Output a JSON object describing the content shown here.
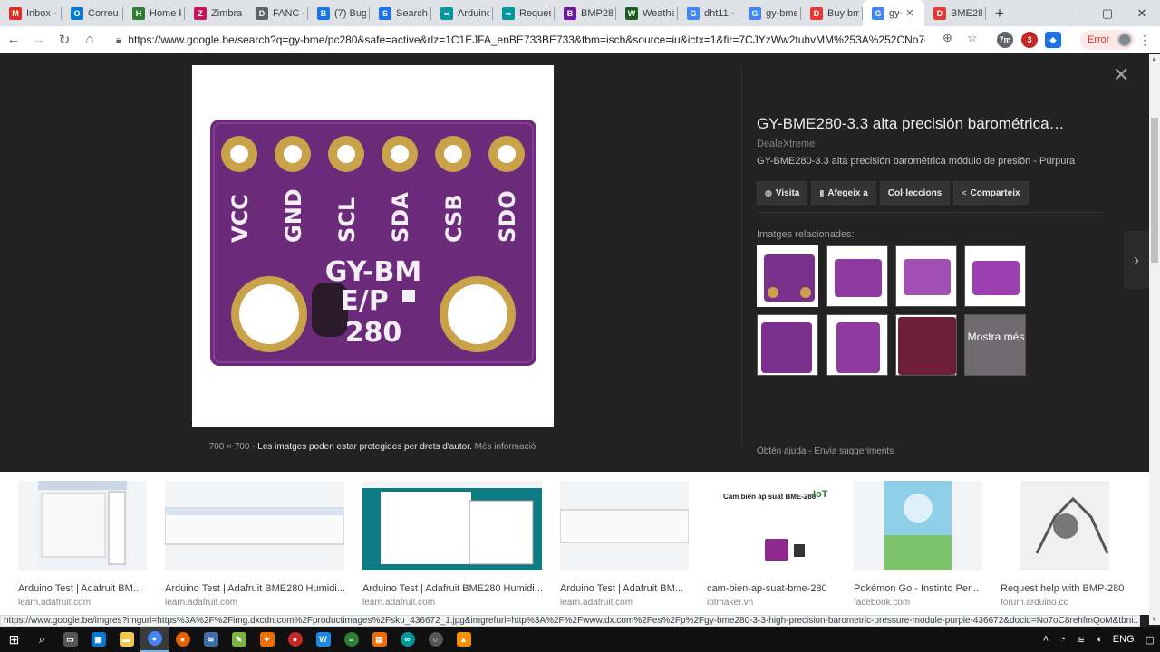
{
  "browser": {
    "tabs": [
      {
        "label": "Inbox -",
        "icon": "gmail-icon",
        "color": "#d93025",
        "glyph": "M"
      },
      {
        "label": "Correu",
        "icon": "outlook-icon",
        "color": "#0078d4",
        "glyph": "O"
      },
      {
        "label": "Home F",
        "icon": "homef-icon",
        "color": "#2e7d32",
        "glyph": "H"
      },
      {
        "label": "Zimbra",
        "icon": "zimbra-icon",
        "color": "#c2185b",
        "glyph": "Z"
      },
      {
        "label": "FANC -",
        "icon": "document-icon",
        "color": "#5f6368",
        "glyph": "D"
      },
      {
        "label": "(7) Bug",
        "icon": "bugzilla-icon",
        "color": "#1a73e8",
        "glyph": "B"
      },
      {
        "label": "Search",
        "icon": "search-tab-icon",
        "color": "#1a73e8",
        "glyph": "S"
      },
      {
        "label": "Arduino",
        "icon": "arduino-icon",
        "color": "#00979d",
        "glyph": "∞"
      },
      {
        "label": "Reques",
        "icon": "arduino-forum-icon",
        "color": "#00979d",
        "glyph": "∞"
      },
      {
        "label": "BMP28",
        "icon": "bmp-icon",
        "color": "#6a1b9a",
        "glyph": "B"
      },
      {
        "label": "Weathe",
        "icon": "weather-icon",
        "color": "#1b5e20",
        "glyph": "W"
      },
      {
        "label": "dht11 -",
        "icon": "google-icon",
        "color": "#4285f4",
        "glyph": "G"
      },
      {
        "label": "gy-bme",
        "icon": "google-icon",
        "color": "#4285f4",
        "glyph": "G"
      },
      {
        "label": "Buy bm",
        "icon": "dx-icon",
        "color": "#e53935",
        "glyph": "D"
      },
      {
        "label": "gy-",
        "icon": "google-icon",
        "color": "#4285f4",
        "glyph": "G",
        "active": true
      },
      {
        "label": "BME28",
        "icon": "dx-icon",
        "color": "#e53935",
        "glyph": "D"
      }
    ],
    "url": "https://www.google.be/search?q=gy-bme/pc280&safe=active&rlz=1C1EJFA_enBE733BE733&tbm=isch&source=iu&ictx=1&fir=7CJYzWw2tuhvMM%253A%252CNo7oC8...",
    "error_label": "Error",
    "status_url": "https://www.google.be/imgres?imgurl=https%3A%2F%2Fimg.dxcdn.com%2Fproductimages%2Fsku_436672_1.jpg&imgrefurl=http%3A%2F%2Fwww.dx.com%2Fes%2Fp%2Fgy-bme280-3-3-high-precision-barometric-pressure-module-purple-436672&docid=No7oC8rehfmQoM&tbni..."
  },
  "preview": {
    "dimensions": "700 × 700",
    "protected_text": "Les imatges poden estar protegides per drets d'autor.",
    "more_info": "Més informació",
    "title": "GY-BME280-3.3 alta precisión barométrica…",
    "source": "DealeXtreme",
    "description": "GY-BME280-3.3 alta precisión barométrica módulo de presión - Púrpura",
    "actions": [
      {
        "label": "Visita",
        "icon": "globe-icon",
        "glyph": "◍"
      },
      {
        "label": "Afegeix a",
        "icon": "bookmark-icon",
        "glyph": "▮"
      },
      {
        "label": "Col·leccions",
        "icon": "",
        "glyph": ""
      },
      {
        "label": "Comparteix",
        "icon": "share-icon",
        "glyph": "<"
      }
    ],
    "related_label": "Imatges relacionades:",
    "show_more": "Mostra més",
    "help": "Obtén ajuda",
    "suggestions": "Envia suggeriments",
    "pin_labels": [
      "VCC",
      "GND",
      "SCL",
      "SDA",
      "CSB",
      "SDO"
    ],
    "board_text": [
      "GY-BM",
      "E/P",
      "280"
    ]
  },
  "results": [
    {
      "title": "Arduino Test | Adafruit BM...",
      "url": "learn.adafruit.com"
    },
    {
      "title": "Arduino Test | Adafruit BME280 Humidi...",
      "url": "learn.adafruit.com"
    },
    {
      "title": "Arduino Test | Adafruit BME280 Humidi...",
      "url": "learn.adafruit.com"
    },
    {
      "title": "Arduino Test | Adafruit BM...",
      "url": "learn.adafruit.com"
    },
    {
      "title": "cam-bien-ap-suat-bme-280",
      "url": "iotmaker.vn",
      "thumb_heading": "Cảm biến áp suất BME-280",
      "thumb_badge": "IoT"
    },
    {
      "title": "Pokémon Go - Instinto Per...",
      "url": "facebook.com"
    },
    {
      "title": "Request help with BMP-280",
      "url": "forum.arduino.cc"
    }
  ],
  "taskbar": {
    "language": "ENG"
  },
  "colors": {
    "board_purple": "#6b2a7a",
    "panel_bg": "#222222",
    "pad_gold": "#c9a24a"
  }
}
